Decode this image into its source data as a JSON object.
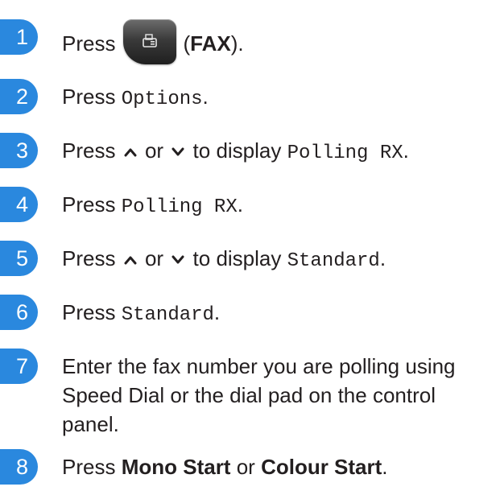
{
  "steps": [
    {
      "number": "1",
      "text_a": "Press",
      "button_label": "FAX",
      "paren_open": "(",
      "paren_close": ")."
    },
    {
      "number": "2",
      "text_a": "Press",
      "mono": "Options",
      "end": "."
    },
    {
      "number": "3",
      "text_a": "Press",
      "or": "or",
      "text_b": "to display",
      "mono": "Polling RX",
      "end": "."
    },
    {
      "number": "4",
      "text_a": "Press",
      "mono": "Polling RX",
      "end": "."
    },
    {
      "number": "5",
      "text_a": "Press",
      "or": "or",
      "text_b": "to display",
      "mono": "Standard",
      "end": "."
    },
    {
      "number": "6",
      "text_a": "Press",
      "mono": "Standard",
      "end": "."
    },
    {
      "number": "7",
      "text": "Enter the fax number you are polling using Speed Dial or the dial pad on the control panel."
    },
    {
      "number": "8",
      "text_a": "Press",
      "bold_a": "Mono Start",
      "or": "or",
      "bold_b": "Colour Start",
      "end": "."
    }
  ],
  "icons": {
    "up": "chevron-up-icon",
    "down": "chevron-down-icon",
    "fax": "fax-icon"
  },
  "colors": {
    "step_badge": "#2a88de",
    "text": "#231f20"
  }
}
